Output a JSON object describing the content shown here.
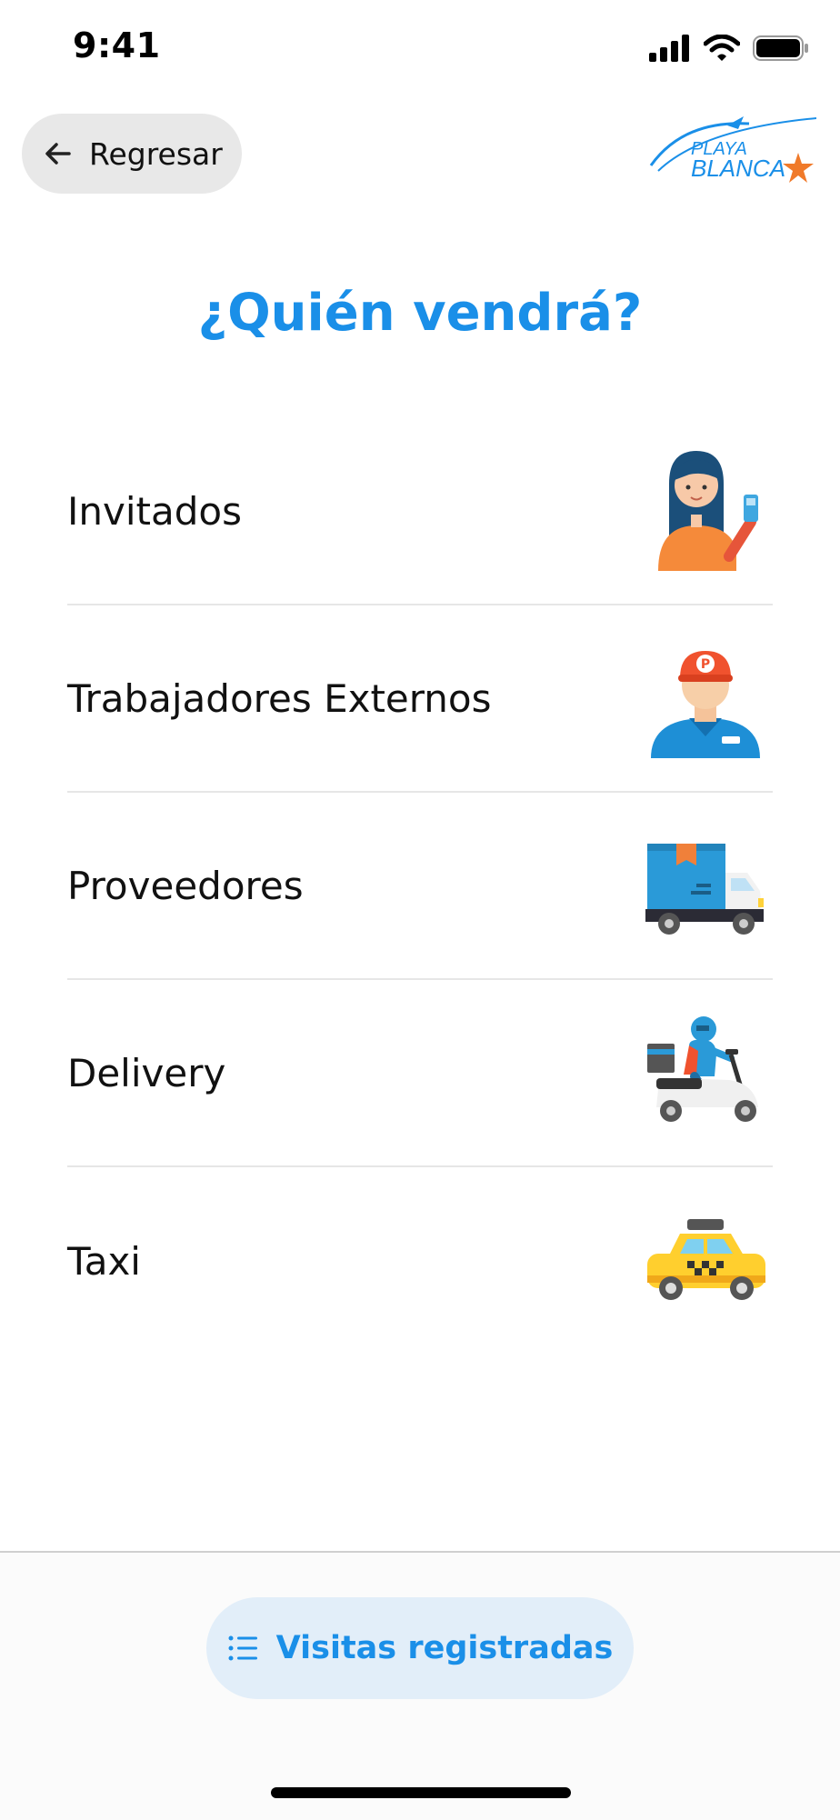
{
  "status_bar": {
    "time": "9:41"
  },
  "header": {
    "back_label": "Regresar",
    "logo_text": "PLAYA BLANCA"
  },
  "page": {
    "title": "¿Quién vendrá?"
  },
  "options": [
    {
      "label": "Invitados",
      "icon": "guest-icon"
    },
    {
      "label": "Trabajadores Externos",
      "icon": "worker-icon"
    },
    {
      "label": "Proveedores",
      "icon": "delivery-truck-icon"
    },
    {
      "label": "Delivery",
      "icon": "scooter-courier-icon"
    },
    {
      "label": "Taxi",
      "icon": "taxi-icon"
    }
  ],
  "footer": {
    "visits_label": "Visitas registradas"
  },
  "colors": {
    "accent": "#1a8fe8",
    "button_bg": "#e2eef9",
    "back_bg": "#e8e8e8"
  }
}
